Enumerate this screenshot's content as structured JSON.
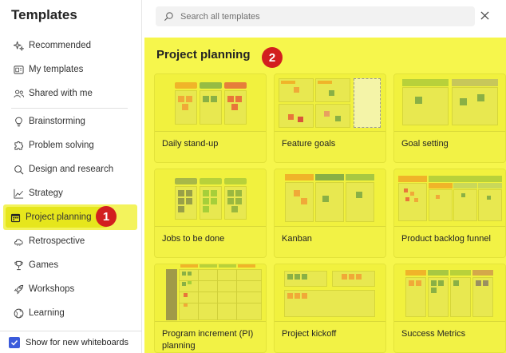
{
  "sidebar": {
    "title": "Templates",
    "items": [
      {
        "label": "Recommended",
        "icon": "sparkle-icon"
      },
      {
        "label": "My templates",
        "icon": "templates-icon"
      },
      {
        "label": "Shared with me",
        "icon": "people-icon"
      },
      {
        "label": "Brainstorming",
        "icon": "lightbulb-icon"
      },
      {
        "label": "Problem solving",
        "icon": "puzzle-icon"
      },
      {
        "label": "Design and research",
        "icon": "magnifier-icon"
      },
      {
        "label": "Strategy",
        "icon": "chart-icon"
      },
      {
        "label": "Project planning",
        "icon": "calendar-icon"
      },
      {
        "label": "Retrospective",
        "icon": "cloud-icon"
      },
      {
        "label": "Games",
        "icon": "trophy-icon"
      },
      {
        "label": "Workshops",
        "icon": "rocket-icon"
      },
      {
        "label": "Learning",
        "icon": "globe-icon"
      }
    ],
    "footer_label": "Show for new whiteboards"
  },
  "search": {
    "placeholder": "Search all templates"
  },
  "annotations": {
    "one": "1",
    "two": "2"
  },
  "main": {
    "title": "Project planning",
    "cards": [
      {
        "label": "Daily stand-up"
      },
      {
        "label": "Feature goals"
      },
      {
        "label": "Goal setting"
      },
      {
        "label": "Jobs to be done"
      },
      {
        "label": "Kanban"
      },
      {
        "label": "Product backlog funnel"
      },
      {
        "label": "Program increment (PI) planning"
      },
      {
        "label": "Project kickoff"
      },
      {
        "label": "Success Metrics"
      }
    ]
  },
  "colors": {
    "highlight": "#f6f64c",
    "active_item": "#e6e61c",
    "badge": "#d21f1f",
    "checkbox": "#3b5bdb"
  }
}
